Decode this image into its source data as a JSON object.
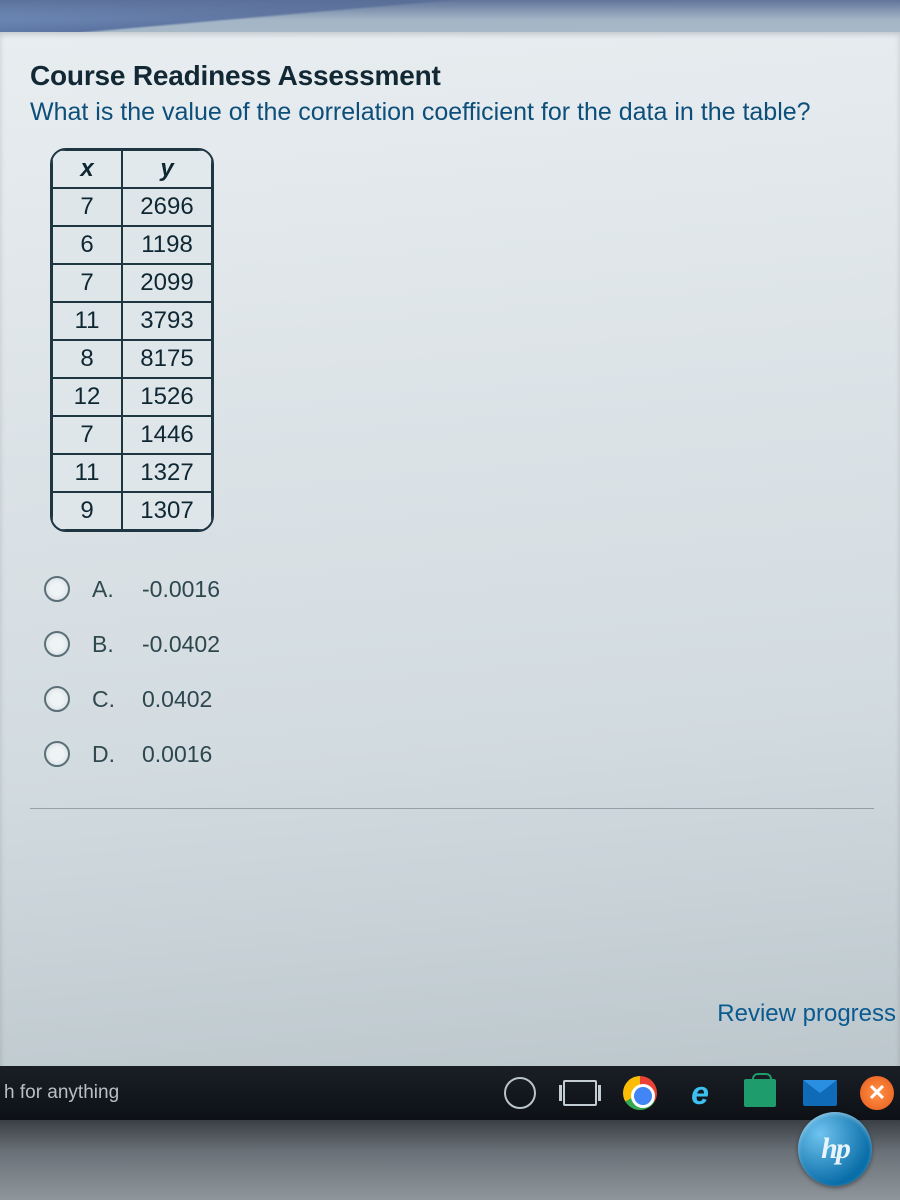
{
  "title": "Course Readiness Assessment",
  "question": "What is the value of the correlation coefficient for the data in the table?",
  "table": {
    "headers": {
      "x": "x",
      "y": "y"
    },
    "rows": [
      {
        "x": "7",
        "y": "2696"
      },
      {
        "x": "6",
        "y": "1198"
      },
      {
        "x": "7",
        "y": "2099"
      },
      {
        "x": "11",
        "y": "3793"
      },
      {
        "x": "8",
        "y": "8175"
      },
      {
        "x": "12",
        "y": "1526"
      },
      {
        "x": "7",
        "y": "1446"
      },
      {
        "x": "11",
        "y": "1327"
      },
      {
        "x": "9",
        "y": "1307"
      }
    ]
  },
  "options": [
    {
      "letter": "A.",
      "value": "-0.0016"
    },
    {
      "letter": "B.",
      "value": "-0.0402"
    },
    {
      "letter": "C.",
      "value": "0.0402"
    },
    {
      "letter": "D.",
      "value": "0.0016"
    }
  ],
  "review_link": "Review progress",
  "taskbar": {
    "search_placeholder": "h for anything"
  },
  "logo": "hp"
}
